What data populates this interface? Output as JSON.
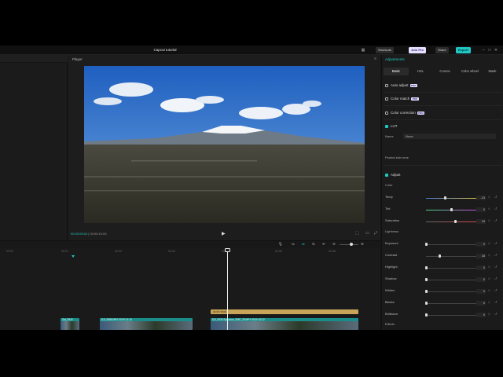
{
  "app": {
    "title": "Capcut tutorial",
    "shortcuts_label": "Shortcuts",
    "pro_label": "Join Pro",
    "share_label": "Share",
    "export_label": "Export"
  },
  "player": {
    "label": "Player",
    "time_current": "00:00:09:04",
    "time_total": "00:00:10:00"
  },
  "adjust": {
    "header": "Adjustments",
    "tabs": [
      "Basic",
      "HSL",
      "Curves",
      "Color wheel",
      "Mask"
    ],
    "active_tab": "Basic",
    "auto_adjust": "Auto adjust",
    "color_match": "Color match",
    "color_correction": "Color correction",
    "pro_badge": "PRO",
    "lut": "LUT",
    "name_label": "Name",
    "name_value": "None",
    "protect_skin": "Protect skin tone",
    "adjust_section": "Adjust",
    "color_group": "Color",
    "lightness_group": "Lightness",
    "effects_group": "Effects",
    "sliders_color": [
      {
        "label": "Temp",
        "value": "-13",
        "pos": 0.38
      },
      {
        "label": "Tint",
        "value": "0",
        "pos": 0.5
      },
      {
        "label": "Saturation",
        "value": "15",
        "pos": 0.58
      }
    ],
    "sliders_light": [
      {
        "label": "Exposure",
        "value": "0",
        "pos": 0.0
      },
      {
        "label": "Contrast",
        "value": "18",
        "pos": 0.28
      },
      {
        "label": "Highlight",
        "value": "0",
        "pos": 0.0
      },
      {
        "label": "Shadow",
        "value": "0",
        "pos": 0.0
      },
      {
        "label": "Whites",
        "value": "0",
        "pos": 0.0
      },
      {
        "label": "Blacks",
        "value": "0",
        "pos": 0.0
      },
      {
        "label": "Brilliance",
        "value": "0",
        "pos": 0.0
      }
    ]
  },
  "timeline": {
    "ruler": [
      "00:00",
      "00:01",
      "00:02",
      "00:03",
      "00:04",
      "00:05",
      "00:06"
    ],
    "audio_clip": "Audio track",
    "clips": [
      {
        "name": "Sat_5940"
      },
      {
        "name": "DJI_0886.MP4  00:00:14:16"
      },
      {
        "name": "DJI_0928 Spacious_SME_29.MP4  00:00:42:12"
      }
    ]
  },
  "colors": {
    "accent": "#21c7c0",
    "background": "#161616",
    "audio_clip": "#c9a55a",
    "video_clip": "#1a8d8a"
  }
}
